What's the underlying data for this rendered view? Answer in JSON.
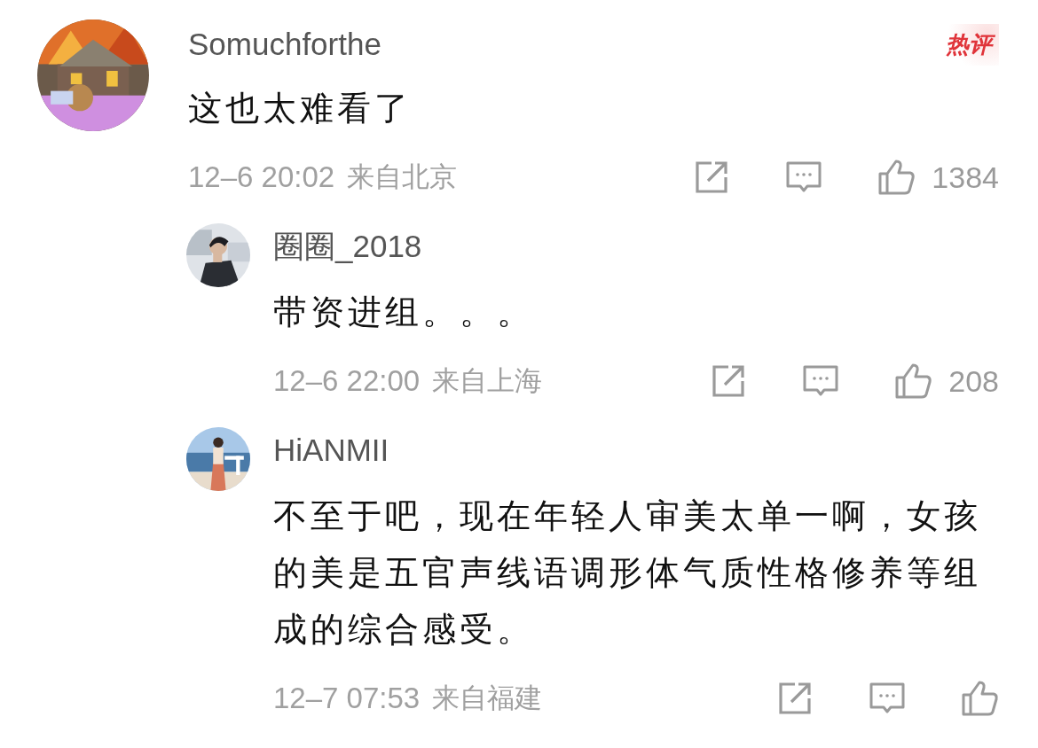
{
  "comments": [
    {
      "username": "Somuchforthe",
      "hot_badge": "热评",
      "text": "这也太难看了",
      "time": "12–6 20:02",
      "location": "来自北京",
      "likes": "1384",
      "children": [
        {
          "username": "圈圈_2018",
          "text": "带资进组。。。",
          "time": "12–6 22:00",
          "location": "来自上海",
          "likes": "208"
        },
        {
          "username": "HiANMII",
          "text": "不至于吧，现在年轻人审美太单一啊，女孩的美是五官声线语调形体气质性格修养等组成的综合感受。",
          "time": "12–7 07:53",
          "location": "来自福建"
        }
      ]
    }
  ]
}
